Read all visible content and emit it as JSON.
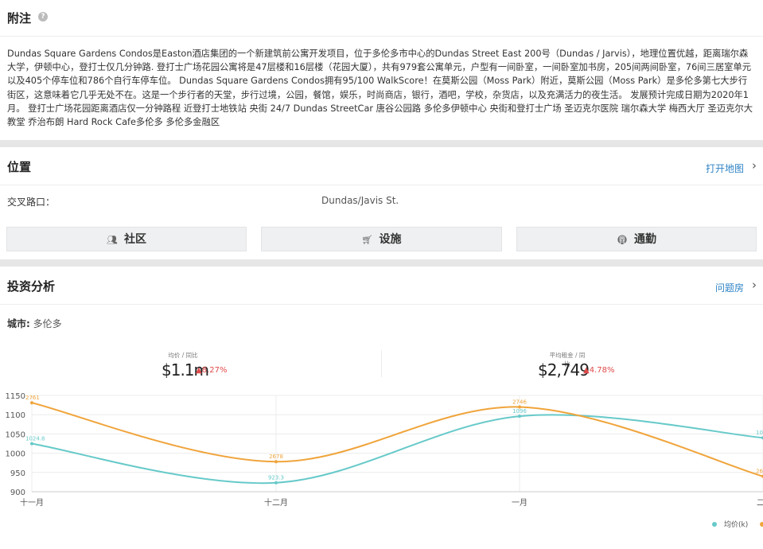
{
  "notes": {
    "title": "附注",
    "help_icon": "question-icon",
    "description": "Dundas Square Gardens Condos是Easton酒店集团的一个新建筑前公寓开发项目，位于多伦多市中心的Dundas Street East 200号（Dundas / Jarvis），地理位置优越，距离瑞尔森大学，伊顿中心，登打士仅几分钟路. 登打士广场花园公寓将是47层楼和16层楼（花园大厦），共有979套公寓单元，户型有一间卧室，一间卧室加书房，205间两间卧室，76间三居室单元以及405个停车位和786个自行车停车位。 Dundas Square Gardens Condos拥有95/100 WalkScore！在莫斯公园（Moss Park）附近，莫斯公园（Moss Park）是多伦多第七大步行街区，这意味着它几乎无处不在。这是一个步行者的天堂，步行过境，公园，餐馆，娱乐，时尚商店，银行，酒吧，学校，杂货店，以及充满活力的夜生活。 发展预计完成日期为2020年1月。 登打士广场花园距离酒店仅一分钟路程 近登打士地铁站 央街 24/7 Dundas StreetCar 唐谷公园路 多伦多伊顿中心 央街和登打士广场 圣迈克尔医院 瑞尔森大学 梅西大厅 圣迈克尔大教堂 乔治布朗 Hard Rock Cafe多伦多 多伦多金融区"
  },
  "location": {
    "title": "位置",
    "map_link": "打开地图",
    "intersection_label": "交叉路口：",
    "intersection_value": "Dundas/Javis St.",
    "buttons": [
      {
        "label": "社区",
        "icon": "people-icon"
      },
      {
        "label": "设施",
        "icon": "cart-icon"
      },
      {
        "label": "通勤",
        "icon": "transit-icon"
      }
    ]
  },
  "investment": {
    "title": "投资分析",
    "link": "问题房",
    "city_label": "城市:",
    "city_value": "多伦多",
    "stats": [
      {
        "label": "均价 / 同比",
        "value": "$1.1m",
        "change": "▲8.27%"
      },
      {
        "label": "平均租金 / 同比",
        "value": "$2,749",
        "change": "▲4.78%"
      }
    ],
    "legend": [
      "均价(k)",
      "平均租金"
    ]
  },
  "colors": {
    "price_series": "#67c9c9",
    "rent_series": "#f0a43b",
    "change_up": "#e04a4a",
    "link": "#2f84c6"
  },
  "chart_data": {
    "type": "line",
    "categories": [
      "十一月",
      "十二月",
      "一月",
      "二月"
    ],
    "ylim": [
      900,
      1150
    ],
    "y_ticks": [
      900,
      950,
      1000,
      1050,
      1100,
      1150
    ],
    "series": [
      {
        "name": "均价(k)",
        "values": [
          1024.8,
          923.3,
          1096.0,
          1040.0
        ],
        "labels": [
          "1024.8",
          "923.3",
          "1096",
          "10"
        ]
      },
      {
        "name": "平均租金",
        "values": [
          1131,
          978,
          1120,
          940
        ],
        "labels": [
          "2761",
          "2678",
          "2746",
          "26"
        ]
      }
    ]
  }
}
